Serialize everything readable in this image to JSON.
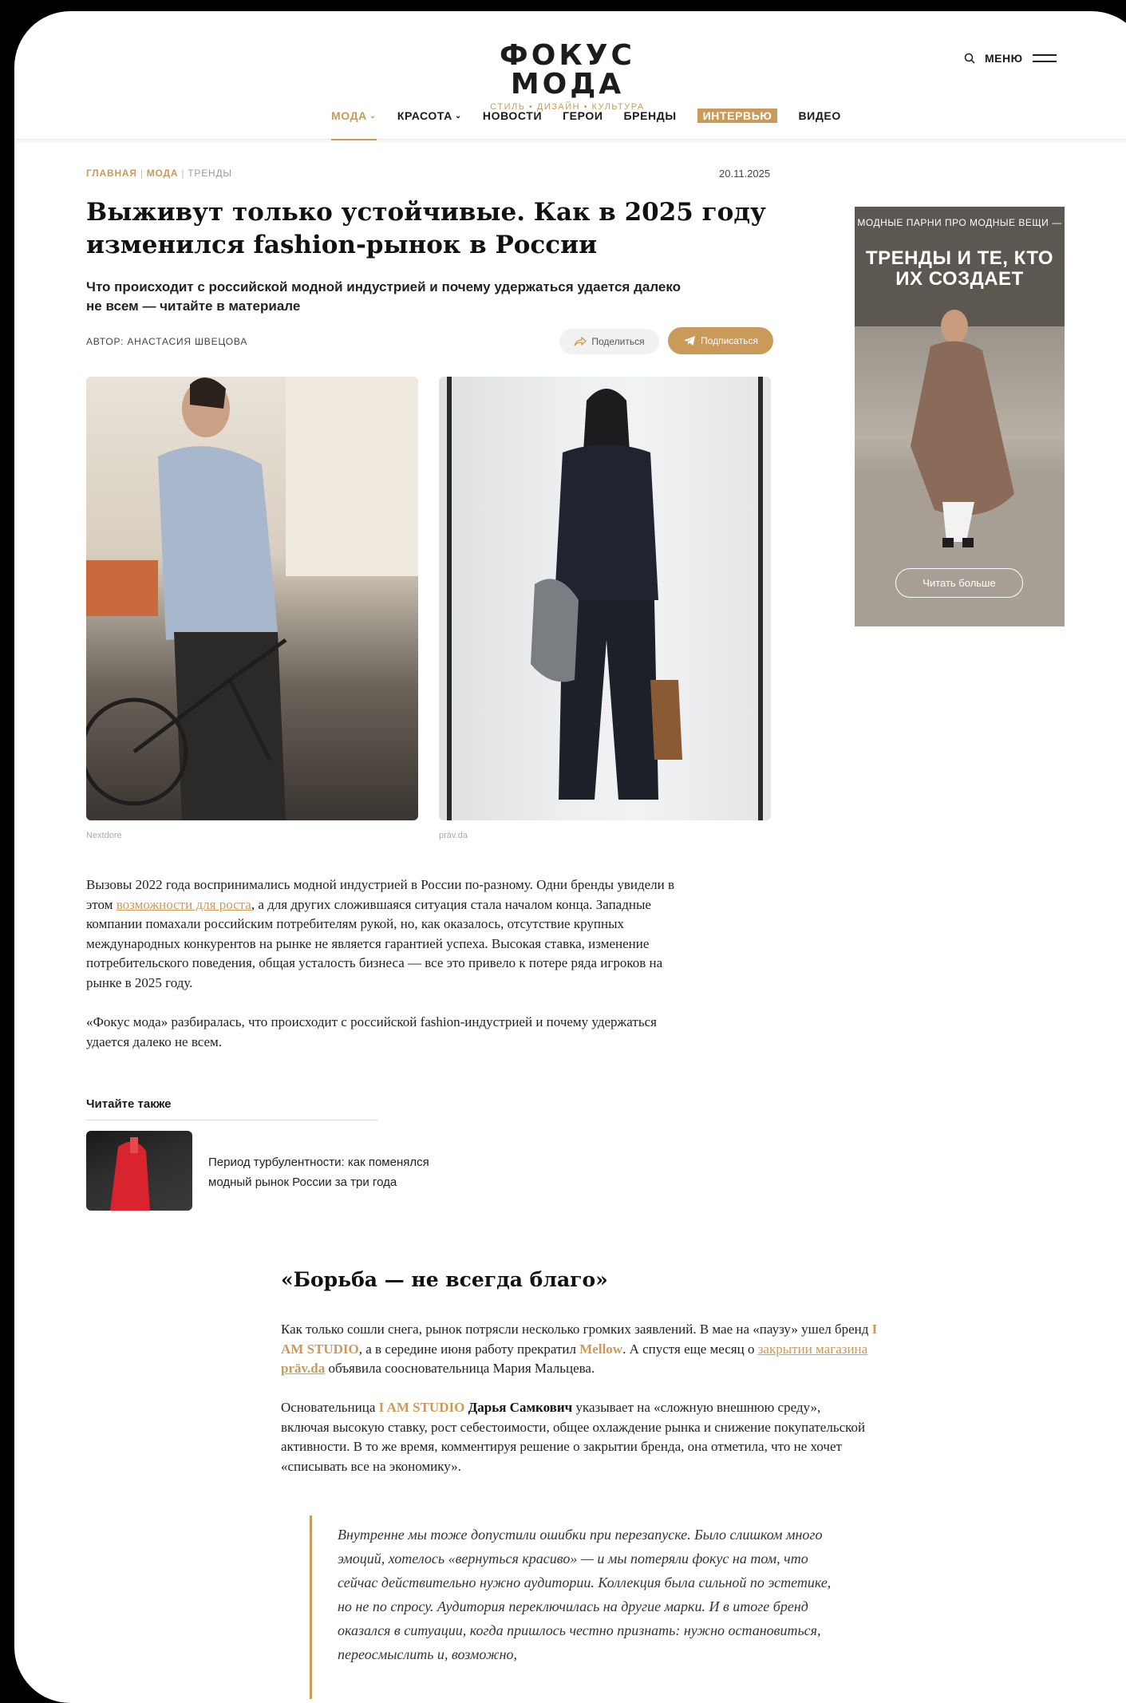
{
  "header": {
    "logo_title": "ФОКУС МОДА",
    "logo_subtitle": "СТИЛЬ • ДИЗАЙН • КУЛЬТУРА",
    "menu_label": "МЕНЮ",
    "nav": [
      {
        "label": "МОДА",
        "chevron": "⌄"
      },
      {
        "label": "КРАСОТА",
        "chevron": "⌄"
      },
      {
        "label": "НОВОСТИ"
      },
      {
        "label": "ГЕРОИ"
      },
      {
        "label": "БРЕНДЫ"
      },
      {
        "label": "ИНТЕРВЬЮ"
      },
      {
        "label": "ВИДЕО"
      }
    ]
  },
  "breadcrumb": [
    "ГЛАВНАЯ",
    "МОДА",
    "ТРЕНДЫ"
  ],
  "breadcrumb_sep": "|",
  "date": "20.11.2025",
  "article": {
    "title": "Выживут только устойчивые. Как в 2025 году изменился fashion-рынок в России",
    "lead": "Что происходит с российской модной индустрией и почему удержаться удается далеко не всем — читайте в материале",
    "author": "АВТОР: АНАСТАСИЯ ШВЕЦОВА",
    "share_label": "Поделиться",
    "subscribe_label": "Подписаться",
    "photo_credits": [
      "Nextdore",
      "präv.da"
    ],
    "p1_before": "Вызовы 2022 года воспринимались модной индустрией в России по-разному. Одни бренды увидели в этом ",
    "p1_link": "возможности для роста",
    "p1_after": ", а для других сложившаяся ситуация стала началом конца. Западные компании помахали российским потребителям рукой, но, как оказалось, отсутствие крупных международных конкурентов на рынке не является гарантией успеха. Высокая ставка, изменение потребительского поведения, общая усталость бизнеса — все это привело к потере ряда игроков на рынке в 2025 году.",
    "p2": "«Фокус мода» разбиралась, что происходит с российской fashion-индустрией и почему удержаться удается далеко не всем.",
    "read_also_heading": "Читайте также",
    "read_also_title": "Период турбулентности: как поменялся модный рынок России за три года",
    "section_heading": "«Борьба — не всегда благо»",
    "p3_1": "Как только сошли снега, рынок потрясли несколько громких заявлений. В мае на «паузу» ушел бренд ",
    "p3_brand1": "I AM STUDIO",
    "p3_2": ", а в середине июня работу прекратил ",
    "p3_brand2": "Mellow",
    "p3_3": ". А спустя еще месяц о ",
    "p3_link": "закрытии магазина",
    "p3_4": " ",
    "p3_brand3": "präv.da",
    "p3_5": " объявила сооснователь­ница Мария Мальцева.",
    "p4_1": "Основательница ",
    "p4_brand": "I AM STUDIO",
    "p4_2": " ",
    "p4_name": "Дарья Самкович",
    "p4_3": " указывает на «сложную внешнюю среду», включая высокую ставку, рост себестоимости, общее охлаждение рынка и снижение покупательской активности. В то же время, комментируя решение о закрытии бренда, она отметила, что не хочет «списывать все на экономику».",
    "quote": "Внутренне мы тоже допустили ошибки при перезапуске. Было слишком много эмоций, хотелось «вернуться красиво» — и мы потеряли фокус на том, что сейчас действительно нужно аудитории. Коллекция была сильной по эстетике, но не по спросу. Аудитория переключилась на другие марки. И в итоге бренд оказался в ситуации, когда пришлось честно признать: нужно остановиться, переосмыслить и, возможно,"
  },
  "ad": {
    "top_text": "МОДНЫЕ ПАРНИ ПРО МОДНЫЕ ВЕЩИ —",
    "big_text": "ТРЕНДЫ И ТЕ, КТО ИХ СОЗДАЕТ",
    "button_label": "Читать больше"
  },
  "colors": {
    "accent": "#c99a5a",
    "text": "#1a1a1a",
    "background": "#ffffff"
  }
}
